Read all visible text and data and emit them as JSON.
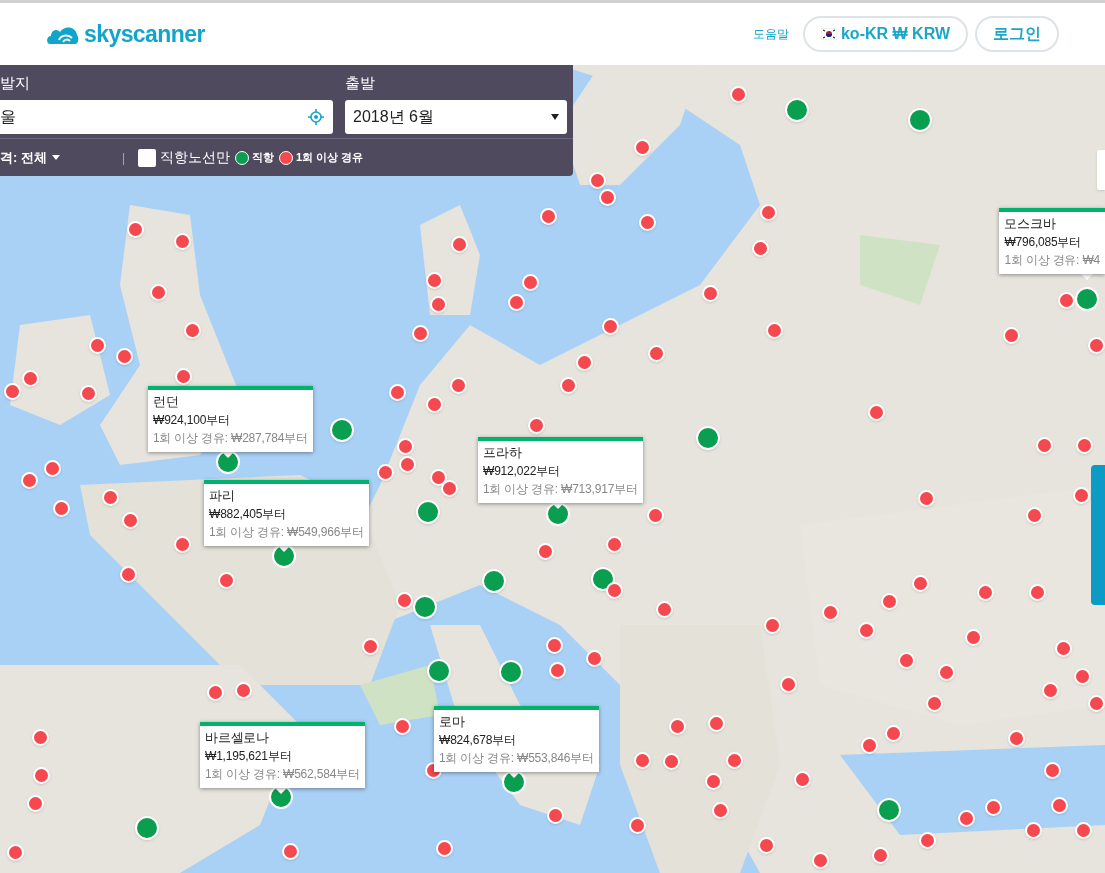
{
  "header": {
    "logo": "skyscanner",
    "help_link": "도움말",
    "locale_button": "ko-KR ₩ KRW",
    "login_button": "로그인"
  },
  "search_panel": {
    "origin_label": "발지",
    "origin_value": "울",
    "depart_label": "출발",
    "depart_value": "2018년 6월",
    "price_filter": "격: 전체",
    "separator": "|",
    "direct_only": {
      "label": "직항노선만",
      "checked": false
    },
    "legend": [
      {
        "label": "직항",
        "color": "#0a9e50"
      },
      {
        "label": "1회 이상 경유",
        "color": "#f5484f"
      }
    ]
  },
  "popups": [
    {
      "city": "런던",
      "price": "₩924,100부터",
      "connecting": "1회 이상 경유: ₩287,784부터"
    },
    {
      "city": "파리",
      "price": "₩882,405부터",
      "connecting": "1회 이상 경유: ₩549,966부터"
    },
    {
      "city": "프라하",
      "price": "₩912,022부터",
      "connecting": "1회 이상 경유: ₩713,917부터"
    },
    {
      "city": "바르셀로나",
      "price": "₩1,195,621부터",
      "connecting": "1회 이상 경유: ₩562,584부터"
    },
    {
      "city": "로마",
      "price": "₩824,678부터",
      "connecting": "1회 이상 경유: ₩553,846부터"
    },
    {
      "city": "모스크바",
      "price": "₩796,085부터",
      "connecting": "1회 이상 경유: ₩4"
    }
  ]
}
